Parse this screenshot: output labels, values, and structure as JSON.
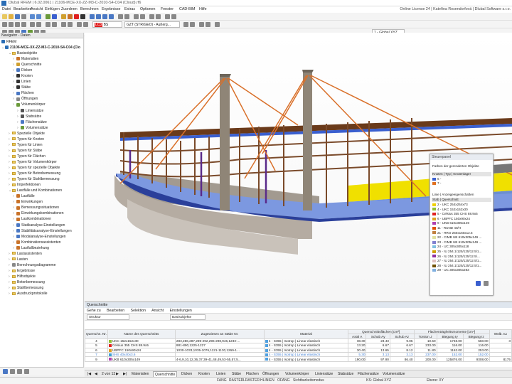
{
  "window": {
    "title": "Dlubal RFEM | 6.02.0061 | 21106-MCE-XX-ZZ-M3-C-2010-S4-C04 (Cloud).rf6"
  },
  "menu": {
    "items": [
      "Datei",
      "Bearbeiten",
      "Ansicht",
      "Einfügen",
      "Zuordnen",
      "Berechnen",
      "Ergebnisse",
      "Extras",
      "Optionen",
      "Fenster",
      "CAD-BIM",
      "Hilfe"
    ],
    "license": "Online License 24 | Kateřina Rosendorfová | Dlubal Software s.r.o."
  },
  "toolbar": {
    "load_case": "GZT (STR/GEO) - Außerg...",
    "coord_system": "1 - Global XYZ",
    "badge1": "LC3",
    "badge2": "BS"
  },
  "navigator": {
    "title": "Navigator - Daten",
    "root": "RFEM",
    "model": "21106-MCE-XX-ZZ-M3-C-2010-S4-C04 (Clo",
    "items": [
      {
        "label": "Basisobjekte",
        "lvl": 1,
        "k": "f",
        "o": 1
      },
      {
        "label": "Materialien",
        "lvl": 2,
        "k": "i",
        "c": "#c9732a"
      },
      {
        "label": "Querschnitte",
        "lvl": 2,
        "k": "i",
        "c": "#d0a030"
      },
      {
        "label": "Dicken",
        "lvl": 2,
        "k": "i",
        "c": "#4a78c4"
      },
      {
        "label": "Knoten",
        "lvl": 2,
        "k": "i",
        "c": "#333"
      },
      {
        "label": "Linien",
        "lvl": 2,
        "k": "i",
        "c": "#333"
      },
      {
        "label": "Stäbe",
        "lvl": 2,
        "k": "i",
        "c": "#333"
      },
      {
        "label": "Flächen",
        "lvl": 2,
        "k": "i",
        "c": "#4a78c4"
      },
      {
        "label": "Öffnungen",
        "lvl": 2,
        "k": "i",
        "c": "#888"
      },
      {
        "label": "Volumenkörper",
        "lvl": 2,
        "k": "i",
        "c": "#6a9a3a"
      },
      {
        "label": "Liniensätze",
        "lvl": 3,
        "k": "i",
        "c": "#555"
      },
      {
        "label": "Stabsätze",
        "lvl": 3,
        "k": "i",
        "c": "#555"
      },
      {
        "label": "Flächensätze",
        "lvl": 3,
        "k": "i",
        "c": "#4a78c4"
      },
      {
        "label": "Volumensätze",
        "lvl": 3,
        "k": "i",
        "c": "#6a9a3a"
      },
      {
        "label": "Spezielle Objekte",
        "lvl": 1,
        "k": "f"
      },
      {
        "label": "Typen für Knoten",
        "lvl": 1,
        "k": "f"
      },
      {
        "label": "Typen für Linien",
        "lvl": 1,
        "k": "f"
      },
      {
        "label": "Typen für Stäbe",
        "lvl": 1,
        "k": "f"
      },
      {
        "label": "Typen für Flächen",
        "lvl": 1,
        "k": "f"
      },
      {
        "label": "Typen für Volumenkörper",
        "lvl": 1,
        "k": "f"
      },
      {
        "label": "Typen für spezielle Objekte",
        "lvl": 1,
        "k": "f"
      },
      {
        "label": "Typen für Betonbemessung",
        "lvl": 1,
        "k": "f"
      },
      {
        "label": "Typen für Stahlbemessung",
        "lvl": 1,
        "k": "f"
      },
      {
        "label": "Imperfektionen",
        "lvl": 1,
        "k": "f"
      },
      {
        "label": "Lastfälle und Kombinationen",
        "lvl": 1,
        "k": "f",
        "o": 1
      },
      {
        "label": "Lastfälle",
        "lvl": 2,
        "k": "i",
        "c": "#c9732a"
      },
      {
        "label": "Einwirkungen",
        "lvl": 2,
        "k": "i",
        "c": "#c9732a"
      },
      {
        "label": "Bemessungssituationen",
        "lvl": 2,
        "k": "i",
        "c": "#c9732a"
      },
      {
        "label": "Einwirkungskombinationen",
        "lvl": 2,
        "k": "i",
        "c": "#c9732a"
      },
      {
        "label": "Lastkombinationen",
        "lvl": 2,
        "k": "i",
        "c": "#c9732a"
      },
      {
        "label": "Statikanalyse-Einstellungen",
        "lvl": 2,
        "k": "i",
        "c": "#4a78c4"
      },
      {
        "label": "Stabilitätsanalyse-Einstellungen",
        "lvl": 2,
        "k": "i",
        "c": "#4a78c4"
      },
      {
        "label": "Modalanalyse-Einstellungen",
        "lvl": 2,
        "k": "i",
        "c": "#4a78c4"
      },
      {
        "label": "Kombinationsassistenten",
        "lvl": 2,
        "k": "i",
        "c": "#c9732a"
      },
      {
        "label": "Lastfallbeziehung",
        "lvl": 2,
        "k": "i",
        "c": "#c9732a"
      },
      {
        "label": "Lastassistenten",
        "lvl": 1,
        "k": "f"
      },
      {
        "label": "Lasten",
        "lvl": 1,
        "k": "f"
      },
      {
        "label": "Berechnungsdiagramme",
        "lvl": 1,
        "k": "i",
        "c": "#888"
      },
      {
        "label": "Ergebnisse",
        "lvl": 1,
        "k": "f"
      },
      {
        "label": "Hilfsobjekte",
        "lvl": 1,
        "k": "f"
      },
      {
        "label": "Betonbemessung",
        "lvl": 1,
        "k": "f"
      },
      {
        "label": "Stahlbemessung",
        "lvl": 1,
        "k": "f"
      },
      {
        "label": "Ausdruckprotokolle",
        "lvl": 1,
        "k": "f"
      }
    ]
  },
  "control_panel": {
    "title": "Steuerpanel",
    "subtitle": "Farben der gerenderten Objekte",
    "sec1": "Knoten | Typ | Knotenlager",
    "sec2": "Linie | Anzeigeeigenschaften",
    "sec3": "Stab | Querschnitt",
    "sec1_items": [
      {
        "label": "6 - ",
        "color": "#3a5fcf"
      },
      {
        "label": "7 - ",
        "color": "#e07020"
      }
    ],
    "items": [
      {
        "label": "2 - UKC 254x254x73",
        "color": "#f0d000"
      },
      {
        "label": "4 - UKC 152x152x30",
        "color": "#90c030"
      },
      {
        "label": "5 - Celsius 355 CHS 88.9x5",
        "color": "#e02020"
      },
      {
        "label": "6 - UBPFC 150x90x24",
        "color": "#e0a020"
      },
      {
        "label": "9 - UKB 610x305x149",
        "color": "#b040b0"
      },
      {
        "label": "11 - RUND 40/H",
        "color": "#e05000"
      },
      {
        "label": "21 - RRO 250x150x12.5",
        "color": "#c08040"
      },
      {
        "label": "22 - CIMB UB 610x305x149 ...",
        "color": "#e0e0a0"
      },
      {
        "label": "23 - CIMB UB 610x305x149 ...",
        "color": "#8080d0"
      },
      {
        "label": "24 - UC 305x305x118",
        "color": "#80c0e0"
      },
      {
        "label": "25 - IU 254.1/125/125/12.5/1...",
        "color": "#d0a000"
      },
      {
        "label": "26 - IU 254.1/125/125/12.5/...",
        "color": "#9030a0"
      },
      {
        "label": "27 - IU 254.1/125/125/12.5/1...",
        "color": "#e0c0c0"
      },
      {
        "label": "28 - IU 254.1/125/125/12.5/1...",
        "color": "#705000"
      },
      {
        "label": "29 - UC 305x305x283",
        "color": "#80b0e0"
      }
    ]
  },
  "panel": {
    "title": "Querschnitte",
    "menu": [
      "Gehe zu",
      "Bearbeiten",
      "Selektion",
      "Ansicht",
      "Einstellungen"
    ],
    "filter": "Struktur",
    "filter2": "Basisobjekte",
    "headers": {
      "no": "Querschn. Nr.",
      "name": "Name des Querschnitts",
      "assigned": "Zugewiesen an Stäbe Nr.",
      "material": "Material",
      "group1": "Querschnittsflächen [cm²]",
      "axial": "Axial A",
      "shear_y": "Schub Ay",
      "shear_z": "Schub Az",
      "group2": "Flächenträgheitsmomente [cm⁴]",
      "torsion": "Torsion J",
      "bend_y": "Biegung Iy",
      "bend_z": "Biegung Iz",
      "warp": "Wölb. Iω"
    },
    "rows": [
      {
        "no": "4",
        "name": "UKC 152x152x30",
        "assigned": "283,286,287,289-292,296-298,946,1233-...",
        "material": "4 - S355 | Isotrop | Linear elastisch",
        "a": "38.30",
        "ay": "23.43",
        "az": "9.05",
        "j": "10.50",
        "iy": "1748.00",
        "iz": "560.00",
        "w": "3",
        "c": "#90c030",
        "mc": "#50a0e0"
      },
      {
        "no": "5",
        "name": "Celsius 355 CHS 88.9x5",
        "assigned": "881-890,1225-1227",
        "material": "4 - S355 | Isotrop | Linear elastisch",
        "a": "13.20",
        "ay": "6.67",
        "az": "6.67",
        "j": "233.00",
        "iy": "116.00",
        "iz": "116.00",
        "w": "",
        "c": "#e02020",
        "mc": "#50a0e0"
      },
      {
        "no": "6",
        "name": "UBPFC 150x90x24",
        "assigned": "1030-1033,1035-1076,1121-1130,1269-1...",
        "material": "4 - S355 | Isotrop | Linear elastisch",
        "a": "30.40",
        "ay": "13.65",
        "az": "8.12",
        "j": "11.80",
        "iy": "1162.00",
        "iz": "253.00",
        "w": "",
        "c": "#e0a020",
        "mc": "#50a0e0"
      },
      {
        "no": "7",
        "name": "SHS 40x40x3.6",
        "assigned": "",
        "material": "4 - S355 | Isotrop | Linear elastisch",
        "a": "5.30",
        "ay": "3.13",
        "az": "3.13",
        "j": "237.00",
        "iy": "152.00",
        "iz": "152.00",
        "w": "",
        "c": "#40a0d0",
        "mc": "#50a0e0"
      },
      {
        "no": "9",
        "name": "UKB 610x305x149",
        "assigned": "4-6,9,10,12,36,37,39-41,48,49,53-55,57,5...",
        "material": "4 - S355 | Isotrop | Linear elastisch",
        "a": "190.00",
        "ay": "97.90",
        "az": "86.40",
        "j": "200.00",
        "iy": "125876.00",
        "iz": "9308.00",
        "w": "8175",
        "c": "#b040b0",
        "mc": "#50a0e0"
      }
    ],
    "pager": "2 von 13"
  },
  "sheet_tabs": [
    "Materialien",
    "Querschnitte",
    "Dicken",
    "Knoten",
    "Linien",
    "Stäbe",
    "Flächen",
    "Öffnungen",
    "Volumenkörper",
    "Liniensätze",
    "Stabsätze",
    "Flächensätze",
    "Volumensätze"
  ],
  "status": {
    "snaps": [
      "FANG",
      "RASTER",
      "LRASTER",
      "HLINIEN",
      "OFANG"
    ],
    "visibility": "Sichtbarkeitsmodus",
    "ks": "KS: Global XYZ",
    "plane": "Ebene: XY"
  },
  "colors": {
    "accent": "#2a6db5",
    "selection": "#3b7bd3",
    "rope": "#d9702a",
    "pylon": "#8f8577",
    "deck_yellow": "#f0e000"
  }
}
